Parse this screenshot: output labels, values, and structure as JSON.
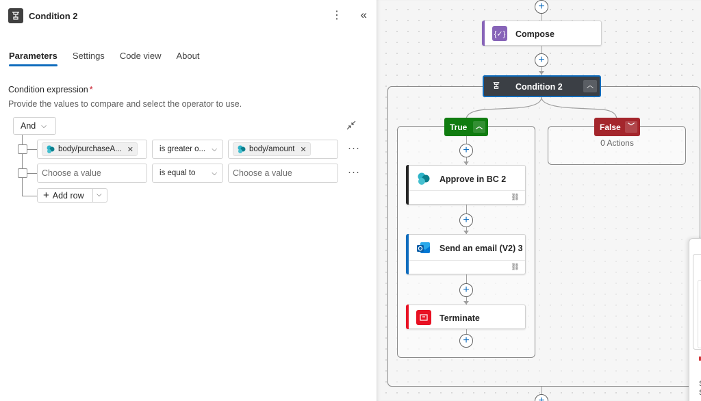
{
  "panel": {
    "title": "Condition 2",
    "icon": "condition-icon",
    "tabs": [
      {
        "label": "Parameters",
        "active": true
      },
      {
        "label": "Settings",
        "active": false
      },
      {
        "label": "Code view",
        "active": false
      },
      {
        "label": "About",
        "active": false
      }
    ],
    "condition_label": "Condition expression",
    "required_mark": "*",
    "condition_description": "Provide the values to compare and select the operator to use.",
    "group_operator": "And",
    "rows": [
      {
        "left_token": "body/purchaseA...",
        "operator": "is greater o...",
        "right_token": "body/amount"
      },
      {
        "left_placeholder": "Choose a value",
        "operator": "is equal to",
        "right_placeholder": "Choose a value"
      }
    ],
    "add_row_label": "Add row",
    "colors": {
      "accent": "#0f6cbd",
      "required": "#c50f1f"
    }
  },
  "canvas": {
    "compose_label": "Compose",
    "condition_label": "Condition 2",
    "true_label": "True",
    "false_label": "False",
    "false_empty": "0 Actions",
    "true_actions": [
      {
        "label": "Approve in BC 2",
        "icon": "business-central-icon",
        "color": "#242424"
      },
      {
        "label": "Send an email (V2) 3",
        "icon": "outlook-icon",
        "color": "#0f6cbd"
      },
      {
        "label": "Terminate",
        "icon": "terminate-icon",
        "color": "#e81123"
      }
    ],
    "side_peek_text": "S\nS",
    "colors": {
      "true": "#107c10",
      "false": "#a4262c",
      "condition_head": "#3b3f45",
      "compose": "#8764b8"
    }
  }
}
